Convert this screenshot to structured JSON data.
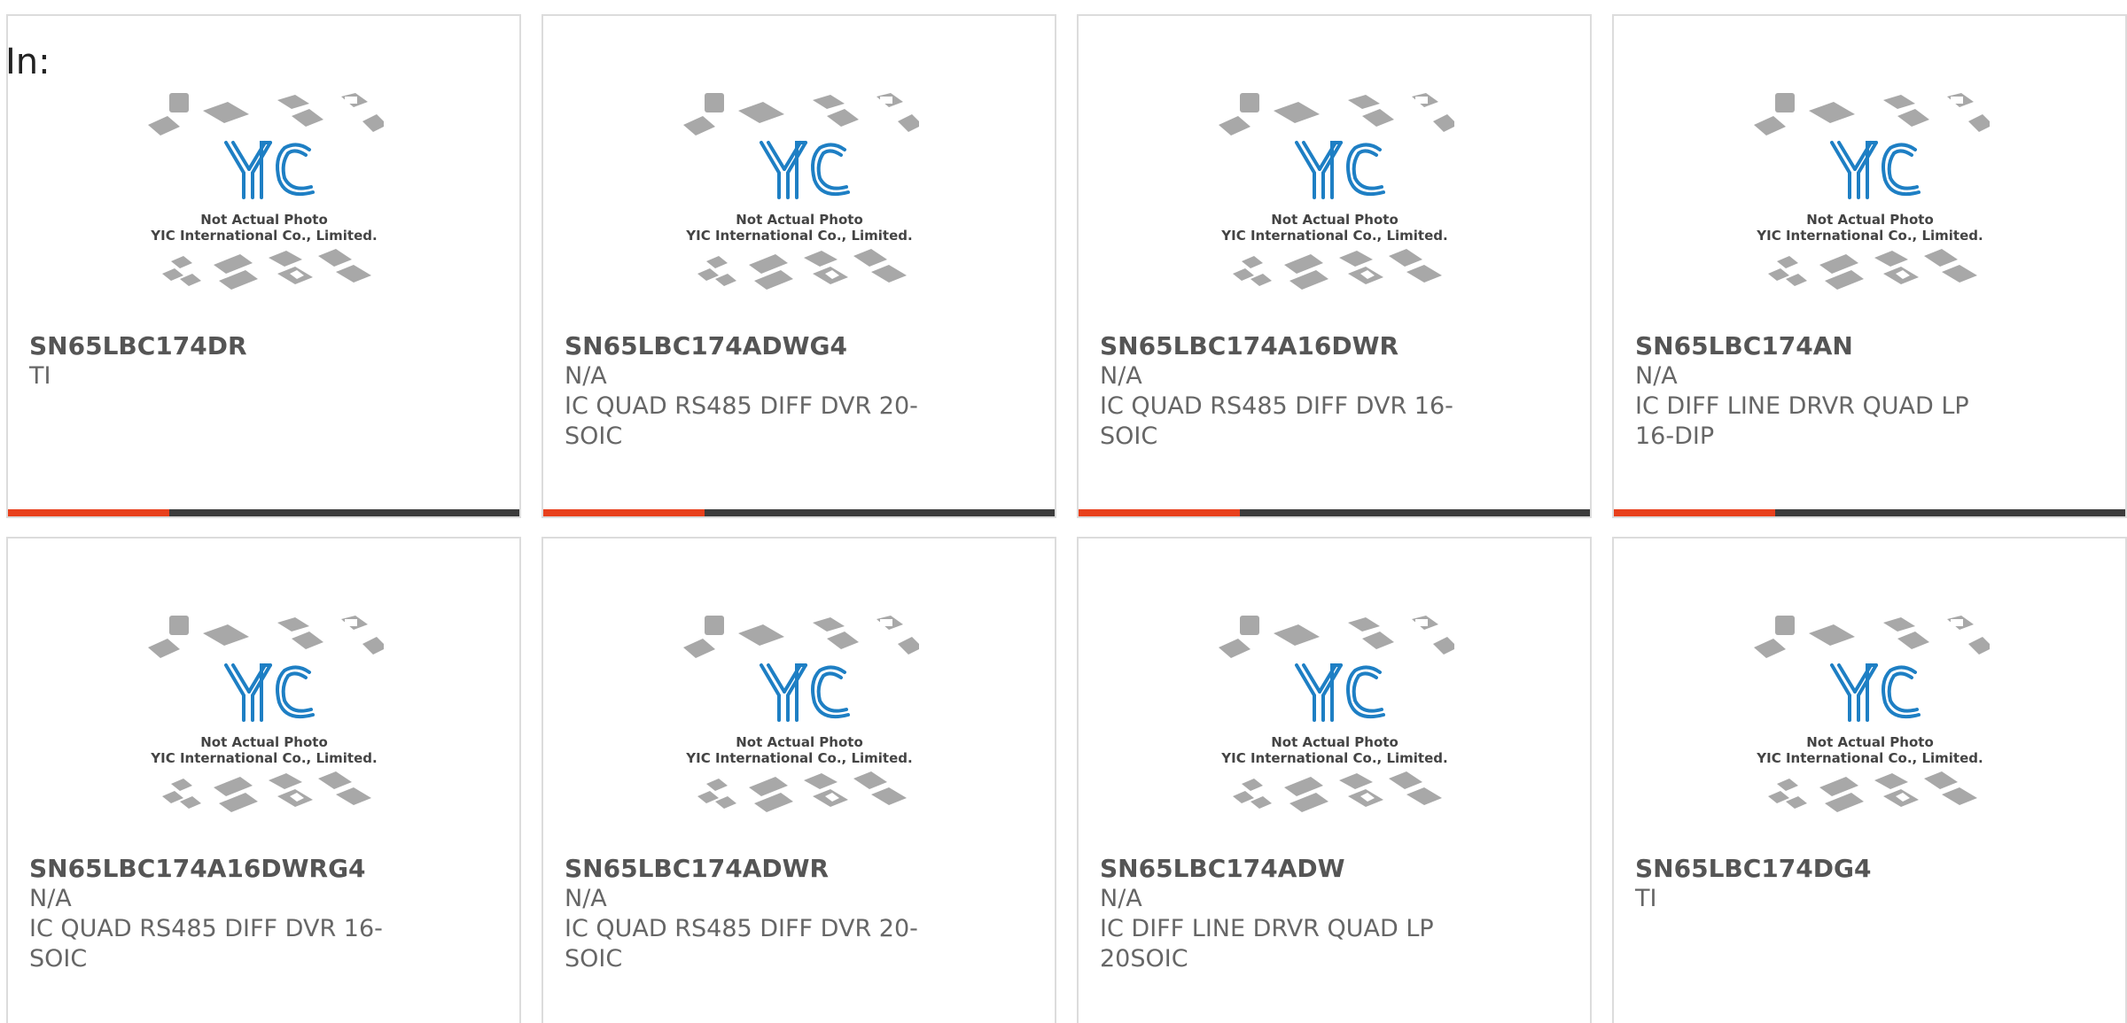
{
  "filter_label": "In:",
  "placeholder_image": {
    "logo_text": "YIC",
    "caption_line1": "Not Actual Photo",
    "caption_line2": "YIC International Co., Limited."
  },
  "colors": {
    "accent": "#e8401c",
    "bar": "#3c3c3c",
    "logo_blue": "#1e7fc4"
  },
  "products": [
    {
      "part": "SN65LBC174DR",
      "maker": "TI",
      "desc": ""
    },
    {
      "part": "SN65LBC174ADWG4",
      "maker": "N/A",
      "desc": "IC QUAD RS485 DIFF DVR 20-SOIC"
    },
    {
      "part": "SN65LBC174A16DWR",
      "maker": "N/A",
      "desc": "IC QUAD RS485 DIFF DVR 16-SOIC"
    },
    {
      "part": "SN65LBC174AN",
      "maker": "N/A",
      "desc": "IC DIFF LINE DRVR QUAD LP 16-DIP"
    },
    {
      "part": "SN65LBC174A16DWRG4",
      "maker": "N/A",
      "desc": "IC QUAD RS485 DIFF DVR 16-SOIC"
    },
    {
      "part": "SN65LBC174ADWR",
      "maker": "N/A",
      "desc": "IC QUAD RS485 DIFF DVR 20-SOIC"
    },
    {
      "part": "SN65LBC174ADW",
      "maker": "N/A",
      "desc": "IC DIFF LINE DRVR QUAD LP 20SOIC"
    },
    {
      "part": "SN65LBC174DG4",
      "maker": "TI",
      "desc": ""
    }
  ]
}
